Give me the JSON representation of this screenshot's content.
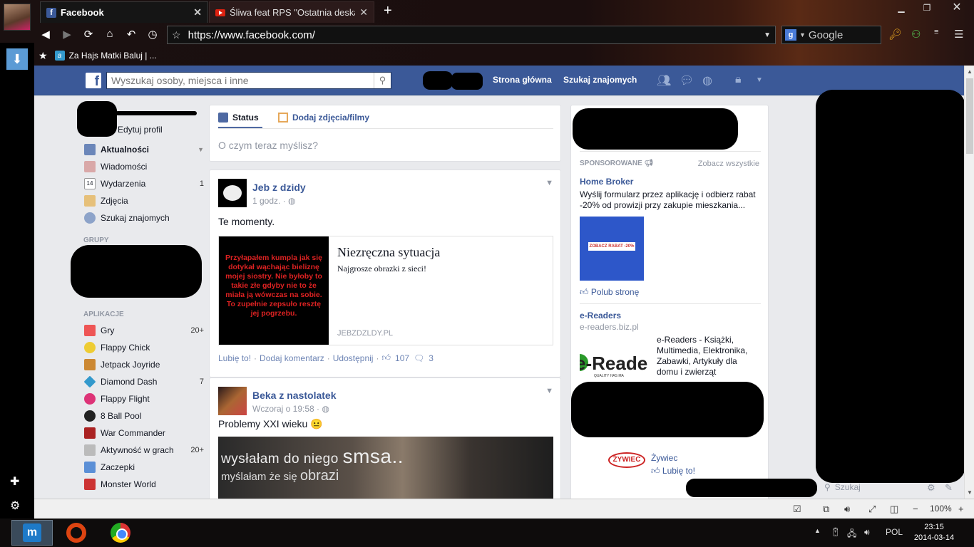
{
  "browser": {
    "tabs": [
      {
        "label": "Facebook",
        "active": true
      },
      {
        "label": "Śliwa feat RPS \"Ostatnia deska ra...",
        "active": false
      }
    ],
    "url": "https://www.facebook.com/",
    "search_engine": "Google",
    "bookmark": "Za Hajs Matki Baluj | ...",
    "zoom": "100%"
  },
  "fb": {
    "search_placeholder": "Wyszukaj osoby, miejsca i inne",
    "nav_home": "Strona główna",
    "nav_find_friends": "Szukaj znajomych"
  },
  "left": {
    "edit_profile": "Edytuj profil",
    "favorites": [
      {
        "label": "Aktualności",
        "count": ""
      },
      {
        "label": "Wiadomości",
        "count": ""
      },
      {
        "label": "Wydarzenia",
        "count": "1"
      },
      {
        "label": "Zdjęcia",
        "count": ""
      },
      {
        "label": "Szukaj znajomych",
        "count": ""
      }
    ],
    "groups_header": "GRUPY",
    "apps_header": "APLIKACJE",
    "apps": [
      {
        "label": "Gry",
        "count": "20+"
      },
      {
        "label": "Flappy Chick",
        "count": ""
      },
      {
        "label": "Jetpack Joyride",
        "count": ""
      },
      {
        "label": "Diamond Dash",
        "count": "7"
      },
      {
        "label": "Flappy Flight",
        "count": ""
      },
      {
        "label": "8 Ball Pool",
        "count": ""
      },
      {
        "label": "War Commander",
        "count": ""
      },
      {
        "label": "Aktywność w grach",
        "count": "20+"
      },
      {
        "label": "Zaczepki",
        "count": ""
      },
      {
        "label": "Monster World",
        "count": ""
      }
    ]
  },
  "composer": {
    "tab_status": "Status",
    "tab_photos": "Dodaj zdjęcia/filmy",
    "placeholder": "O czym teraz myślisz?"
  },
  "posts": [
    {
      "author": "Jeb z dzidy",
      "time": "1 godz.",
      "text": "Te momenty.",
      "link_image_text": "Przyłapałem kumpla jak się dotykał wąchając bieliznę mojej siostry. Nie byłoby to takie złe gdyby nie to że miała ją wówczas na sobie. To zupełnie zepsuło resztę jej pogrzebu.",
      "link_title": "Niezręczna sytuacja",
      "link_desc": "Najgrosze obrazki z sieci!",
      "link_domain": "JEBZDZLDY.PL",
      "like": "Lubię to!",
      "comment": "Dodaj komentarz",
      "share": "Udostępnij",
      "likes": "107",
      "comments": "3"
    },
    {
      "author": "Beka z nastolatek",
      "time": "Wczoraj o 19:58",
      "text": "Problemy XXI wieku 😐",
      "image_line1a": "wysłałam do niego ",
      "image_line1b": "smsa..",
      "image_line2a": "myślałam że się ",
      "image_line2b": "obrazi"
    }
  ],
  "sponsored": {
    "header": "SPONSOROWANE",
    "see_all": "Zobacz wszystkie",
    "ads": [
      {
        "title": "Home Broker",
        "desc": "Wyślij formularz przez aplikację i odbierz rabat -20% od prowizji przy zakupie mieszkania...",
        "image_button": "ZOBACZ RABAT -20%",
        "like": "Polub stronę"
      },
      {
        "title": "e-Readers",
        "url": "e-readers.biz.pl",
        "desc": "e-Readers - Książki, Multimedia, Elektronika, Zabawki, Artykuły dla domu i zwierząt",
        "logo_text": "e-Reade",
        "logo_sub": "QUALITY HAS MA"
      },
      {
        "title": "Żywiec",
        "like": "Lubię to!",
        "logo_text": "ŻYWIEC"
      }
    ]
  },
  "chat": {
    "search": "Szukaj"
  },
  "taskbar": {
    "lang": "POL",
    "time": "23:15",
    "date": "2014-03-14"
  }
}
